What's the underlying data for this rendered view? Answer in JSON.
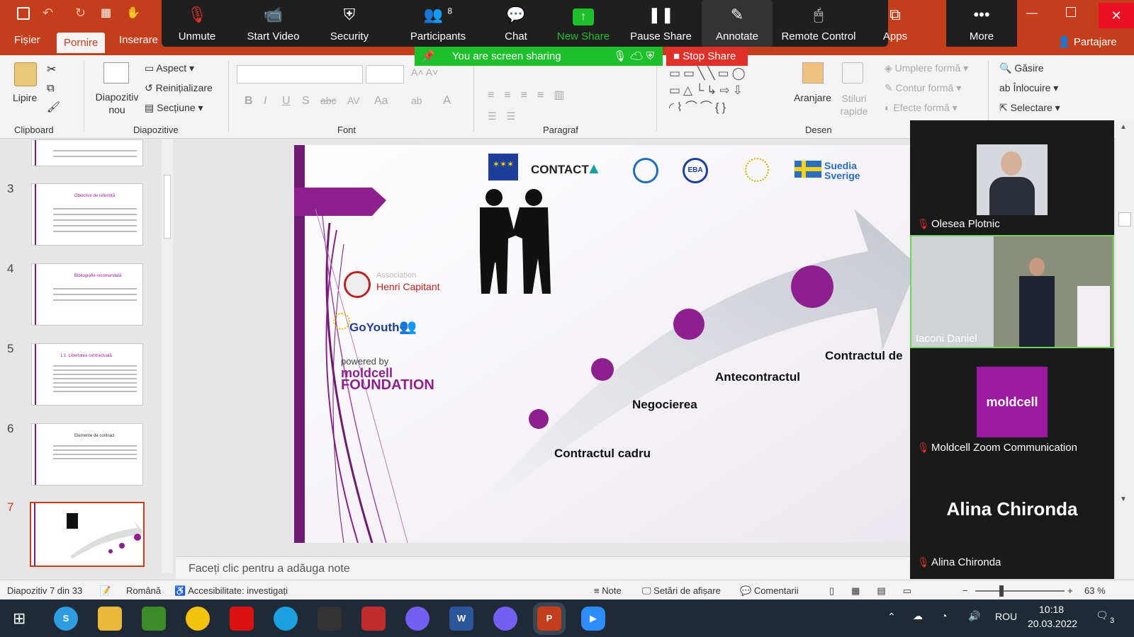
{
  "titlebar": {
    "partajare": "Partajare"
  },
  "menu_tabs": [
    "Fișier",
    "Pornire",
    "Inserare"
  ],
  "zoom": {
    "buttons": [
      {
        "label": "Unmute",
        "icon": "mic-off-icon"
      },
      {
        "label": "Start Video",
        "icon": "video-off-icon"
      },
      {
        "label": "Security",
        "icon": "shield-icon"
      },
      {
        "label": "Participants",
        "icon": "participants-icon",
        "count": "8"
      },
      {
        "label": "Chat",
        "icon": "chat-icon"
      },
      {
        "label": "New Share",
        "icon": "share-icon"
      },
      {
        "label": "Pause Share",
        "icon": "pause-icon"
      },
      {
        "label": "Annotate",
        "icon": "pencil-icon"
      },
      {
        "label": "Remote Control",
        "icon": "remote-icon"
      },
      {
        "label": "Apps",
        "icon": "apps-icon"
      },
      {
        "label": "More",
        "icon": "more-icon"
      }
    ],
    "sharing_text": "You are screen sharing",
    "stop_share": "Stop Share",
    "participants": [
      {
        "name": "Olesea Plotnic"
      },
      {
        "name": "Iaconi Daniel"
      },
      {
        "name": "Moldcell Zoom Communication"
      },
      {
        "name": "Alina Chironda",
        "big": "Alina Chironda"
      }
    ]
  },
  "ribbon": {
    "clipboard": {
      "paste": "Lipire",
      "label": "Clipboard"
    },
    "slides": {
      "new_slide": "Diapozitiv nou",
      "layout": "Aspect",
      "reset": "Reinițializare",
      "section": "Secțiune",
      "label": "Diapozitive"
    },
    "font": {
      "label": "Font"
    },
    "paragraph": {
      "label": "Paragraf"
    },
    "drawing": {
      "arrange": "Aranjare",
      "styles": "Stiluri rapide",
      "fill": "Umplere formă",
      "outline": "Contur formă",
      "effects": "Efecte formă",
      "label": "Desen"
    },
    "editing": {
      "find": "Găsire",
      "replace": "Înlocuire",
      "select": "Selectare"
    }
  },
  "thumbnails": [
    {
      "num": "3",
      "title": "Obiective de referință"
    },
    {
      "num": "4",
      "title": "Bibliografie recomandată"
    },
    {
      "num": "5",
      "title": "1.1. Libertatea contractuală"
    },
    {
      "num": "6",
      "title": "Elemente de contract"
    },
    {
      "num": "7",
      "title": ""
    }
  ],
  "slide": {
    "logos": [
      "CONTACT",
      "EBA",
      "Suedia Sverige"
    ],
    "assoc_small": "Association",
    "assoc": "Henri Capitant",
    "goyouth": "GoYouth+",
    "powered": "powered by",
    "moldcell": "moldcell",
    "foundation": "FOUNDATION",
    "steps": [
      "Contractul cadru",
      "Negocierea",
      "Antecontractul",
      "Contractul de"
    ]
  },
  "notes_placeholder": "Faceți clic pentru a adăuga note",
  "status": {
    "slide_of": "Diapozitiv 7 din 33",
    "language": "Română",
    "accessibility": "Accesibilitate: investigați",
    "notes": "Note",
    "display": "Setări de afișare",
    "comments": "Comentarii",
    "zoom": "63 %"
  },
  "taskbar": {
    "lang": "ROU",
    "time": "10:18",
    "date": "20.03.2022",
    "notif": "3"
  },
  "colors": {
    "accent": "#c43e1c",
    "purple": "#7a1f7e",
    "green": "#1dbf2a",
    "red": "#e0302a"
  }
}
